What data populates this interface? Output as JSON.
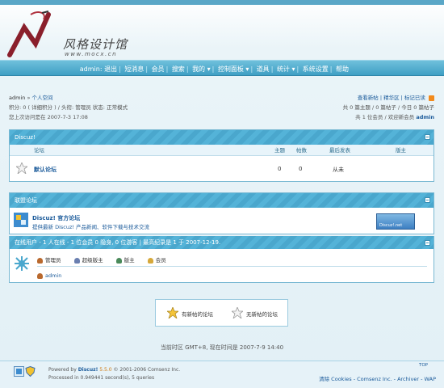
{
  "logo": {
    "title": "风格设计馆",
    "subtitle": "www.mocx.cn"
  },
  "nav": {
    "items": [
      {
        "label": "admin:"
      },
      {
        "label": "退出"
      },
      {
        "label": "短消息"
      },
      {
        "label": "会员"
      },
      {
        "label": "搜索"
      },
      {
        "label": "我的 ▾"
      },
      {
        "label": "控制面板 ▾"
      },
      {
        "label": "道具"
      },
      {
        "label": "统计 ▾"
      },
      {
        "label": "系统设置"
      },
      {
        "label": "帮助"
      }
    ]
  },
  "user_panel": {
    "username": "admin",
    "space_link": "个人空间",
    "line2": "积分: 0 ( 详细积分 ) / 头衔: 管理员 状态: 正常模式",
    "line3": "您上次访问是在 2007-7-3 17:08"
  },
  "right_panel": {
    "links": "查看新帖 | 精华区 | 标记已读",
    "stats1": "共 0 篇主题 / 0 篇帖子 / 今日 0 篇帖子",
    "stats2": "共 1 位会员 / 欢迎新会员",
    "new_member": "admin"
  },
  "forum_box": {
    "header": "Discuz!",
    "col_forum": "论坛",
    "col_topics": "主题",
    "col_posts": "帖数",
    "col_last": "最后发表",
    "col_mod": "版主",
    "row_name": "默认论坛",
    "row_topics": "0",
    "row_posts": "0",
    "row_last": "从未"
  },
  "link_box": {
    "header": "联盟论坛",
    "title": "Discuz! 官方论坛",
    "desc": "提供最新 Discuz! 产品新闻、软件下载与技术交流",
    "banner_text": "Discuz!.net"
  },
  "online_box": {
    "header": "在线用户 - 1 人在线 - 1 位会员 0 隐身, 0 位游客 | 最高纪录是 1 于 2007-12-19.",
    "legend": [
      "管理员",
      "超级版主",
      "版主",
      "会员"
    ],
    "user": "admin"
  },
  "legend_box": {
    "new_posts": "有新帖的论坛",
    "no_new_posts": "无新帖的论坛"
  },
  "timezone": "当前时区 GMT+8, 现在时间是 2007-7-9 14:40",
  "footer": {
    "top": "TOP",
    "powered_prefix": "Powered by",
    "brand": "Discuz!",
    "version": "5.5.0",
    "copyright": "© 2001-2006 Comsenz Inc.",
    "processed": "Processed in 0.949441 second(s), 5 queries",
    "right_links": "清除 Cookies - Comsenz Inc. - Archiver - WAP"
  },
  "colors": {
    "accent": "#4aa7cd",
    "link": "#1a5a9a",
    "nav_bg": "#3f9fc4"
  }
}
